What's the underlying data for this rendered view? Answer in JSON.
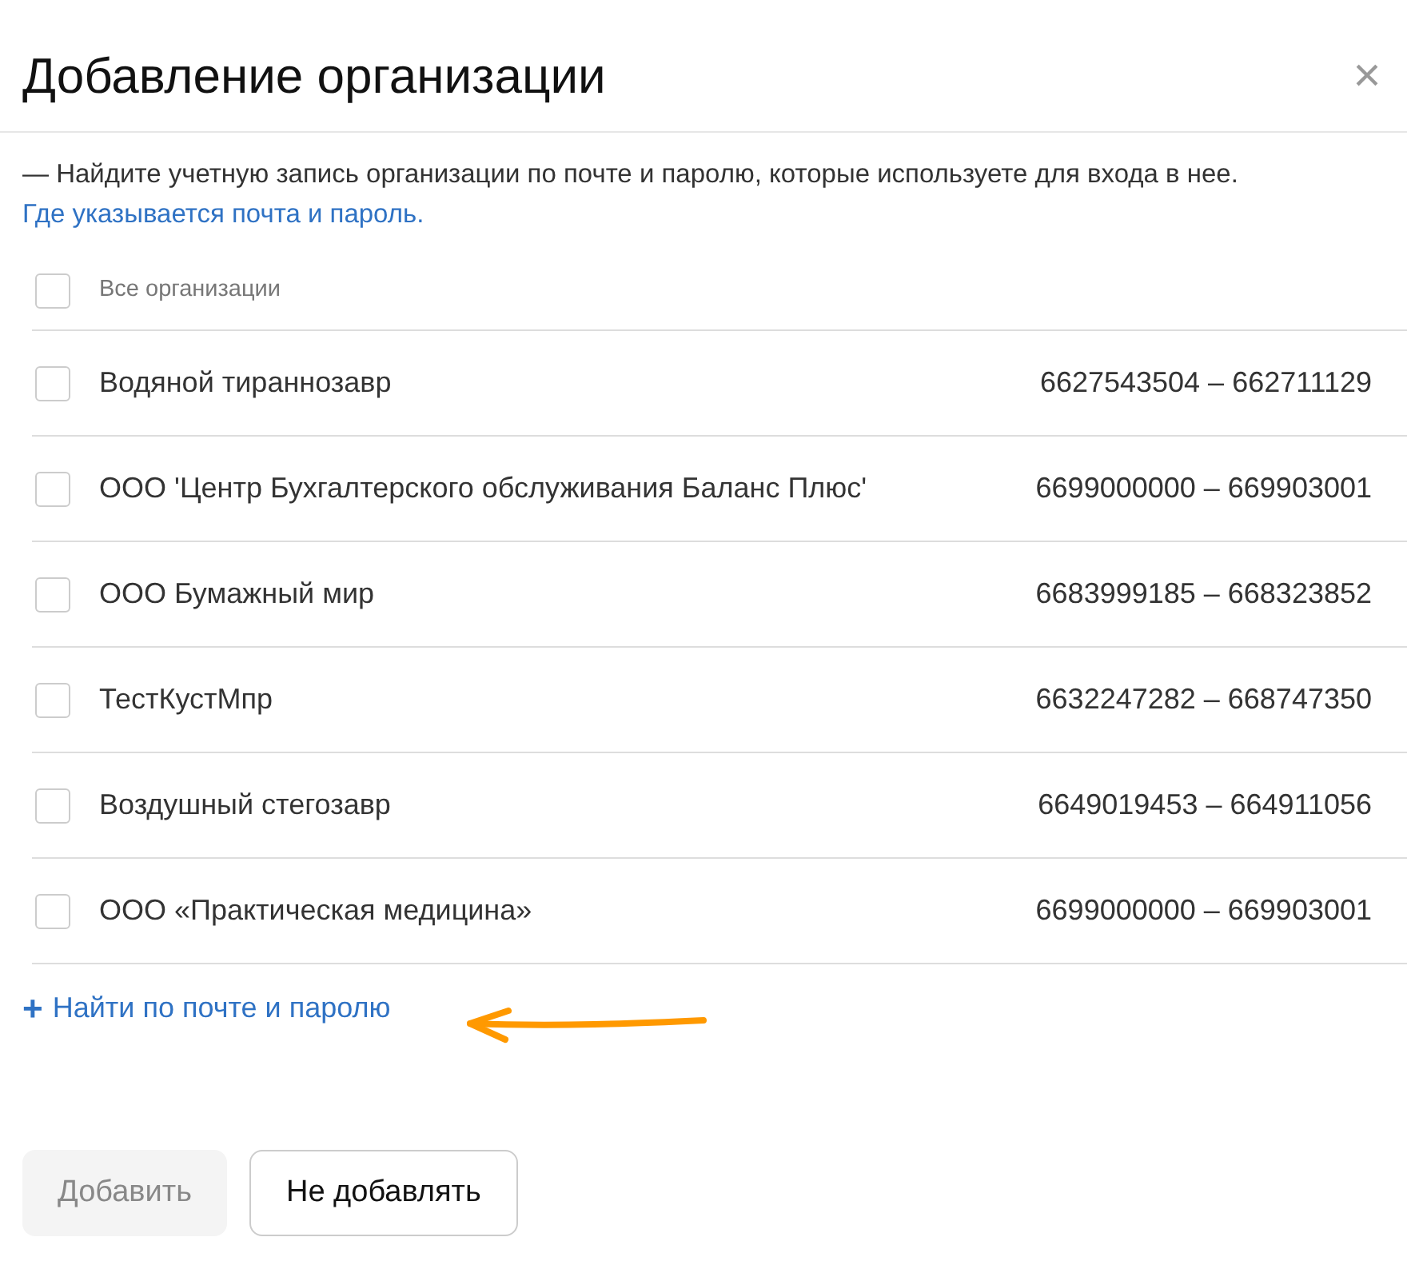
{
  "dialog": {
    "title": "Добавление организации",
    "close": "×"
  },
  "hint": "— Найдите учетную запись организации по почте и паролю, которые используете для входа в нее.",
  "help_link": "Где указывается почта и пароль.",
  "select_all": {
    "label": "Все организации",
    "checked": false
  },
  "organizations": [
    {
      "name": "Водяной тираннозавр",
      "codes": "6627543504 – 662711129",
      "checked": false
    },
    {
      "name": "ООО 'Центр Бухгалтерского обслуживания Баланс Плюс'",
      "codes": "6699000000 – 669903001",
      "checked": false
    },
    {
      "name": "ООО Бумажный мир",
      "codes": "6683999185 – 668323852",
      "checked": false
    },
    {
      "name": "ТестКустМпр",
      "codes": "6632247282 – 668747350",
      "checked": false
    },
    {
      "name": "Воздушный стегозавр",
      "codes": "6649019453 – 664911056",
      "checked": false
    },
    {
      "name": "ООО «Практическая медицина»",
      "codes": "6699000000 – 669903001",
      "checked": false
    }
  ],
  "find_link": {
    "icon": "+",
    "label": "Найти по почте и паролю"
  },
  "buttons": [
    {
      "label": "Добавить",
      "disabled": true
    },
    {
      "label": "Не добавлять",
      "disabled": false
    }
  ]
}
